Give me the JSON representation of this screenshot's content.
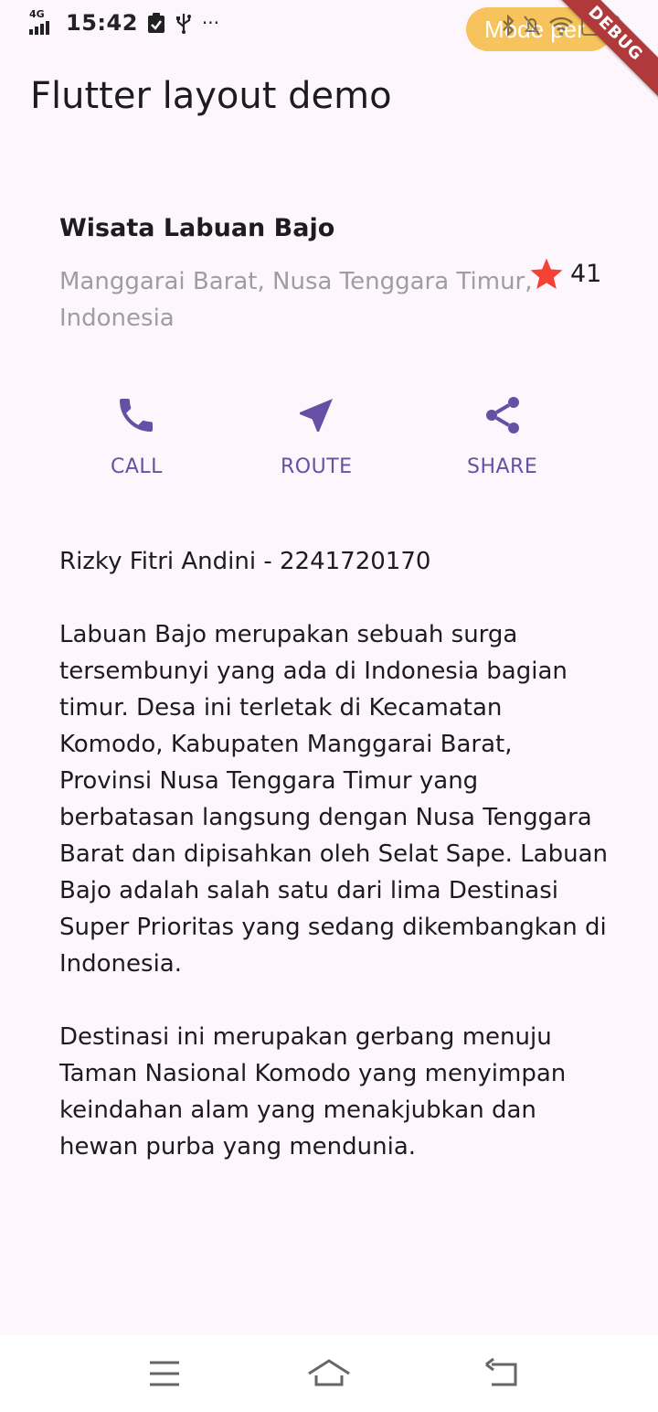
{
  "status_bar": {
    "network": "4G",
    "time": "15:42",
    "more": "···",
    "mode_pill": "Mode per",
    "battery": "100",
    "debug_banner": "DEBUG"
  },
  "app_bar": {
    "title": "Flutter layout demo"
  },
  "place": {
    "title": "Wisata Labuan Bajo",
    "location": "Manggarai Barat, Nusa Tenggara Timur, Indonesia",
    "rating": "41"
  },
  "actions": [
    {
      "label": "CALL",
      "icon": "phone-icon"
    },
    {
      "label": "ROUTE",
      "icon": "near-me-icon"
    },
    {
      "label": "SHARE",
      "icon": "share-icon"
    }
  ],
  "description": {
    "author": "Rizky Fitri Andini - 2241720170",
    "paragraph1": "Labuan Bajo merupakan sebuah surga tersembunyi yang ada di Indonesia bagian timur. Desa ini terletak di Kecamatan Komodo, Kabupaten Manggarai Barat, Provinsi Nusa Tenggara Timur yang berbatasan langsung dengan Nusa Tenggara Barat dan dipisahkan oleh Selat Sape. Labuan Bajo adalah salah satu dari lima Destinasi Super Prioritas yang sedang dikembangkan di Indonesia.",
    "paragraph2": "Destinasi ini merupakan gerbang menuju Taman Nasional Komodo yang menyimpan keindahan alam yang menakjubkan dan hewan purba yang mendunia."
  },
  "colors": {
    "primary": "#6750a4",
    "star": "#f44336",
    "background": "#fdf7fd",
    "subtitle": "#9e9e9e"
  },
  "nav_bar": {
    "icons": [
      "menu-icon",
      "home-icon",
      "back-icon"
    ]
  }
}
